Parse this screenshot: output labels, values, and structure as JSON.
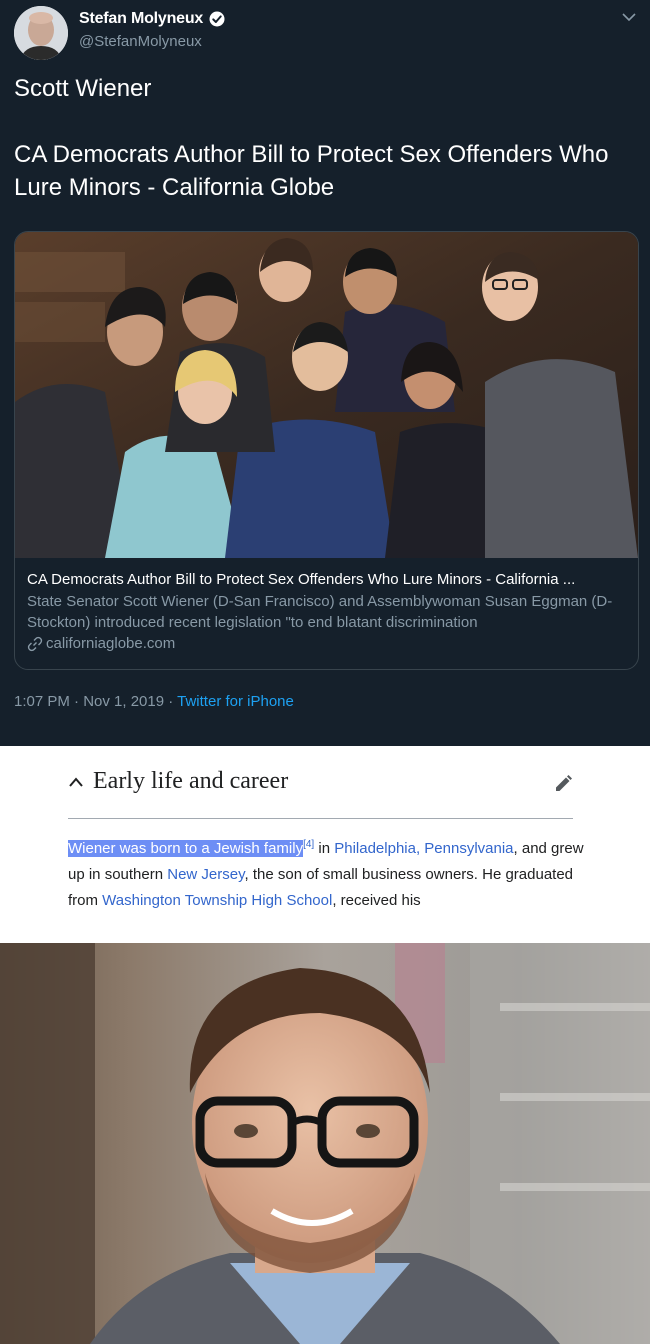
{
  "tweet": {
    "author_name": "Stefan Molyneux",
    "author_handle": "@StefanMolyneux",
    "line1": "Scott Wiener",
    "line2": "CA Democrats Author Bill to Protect Sex Offenders Who Lure Minors - California Globe",
    "card": {
      "title": "CA Democrats Author Bill to Protect Sex Offenders Who Lure Minors - California ...",
      "description": "State Senator Scott Wiener (D-San Francisco) and Assemblywoman Susan Eggman (D-Stockton) introduced recent legislation \"to end blatant discrimination",
      "domain": "californiaglobe.com"
    },
    "time": "1:07 PM · Nov 1, 2019 · ",
    "source": "Twitter for iPhone",
    "colors": {
      "background": "#15202b",
      "link": "#1da1f2",
      "muted": "#8899a6"
    }
  },
  "wiki": {
    "section_title": "Early life and career",
    "highlight": "Wiener was born to a Jewish family",
    "ref": "[4]",
    "t1": " in ",
    "link1": "Philadelphia, Pennsylvania",
    "t2": ", and grew up in southern ",
    "link2": "New Jersey",
    "t3": ", the son of small business owners. He graduated from ",
    "link3": "Washington Township High School",
    "t4": ", received his"
  }
}
